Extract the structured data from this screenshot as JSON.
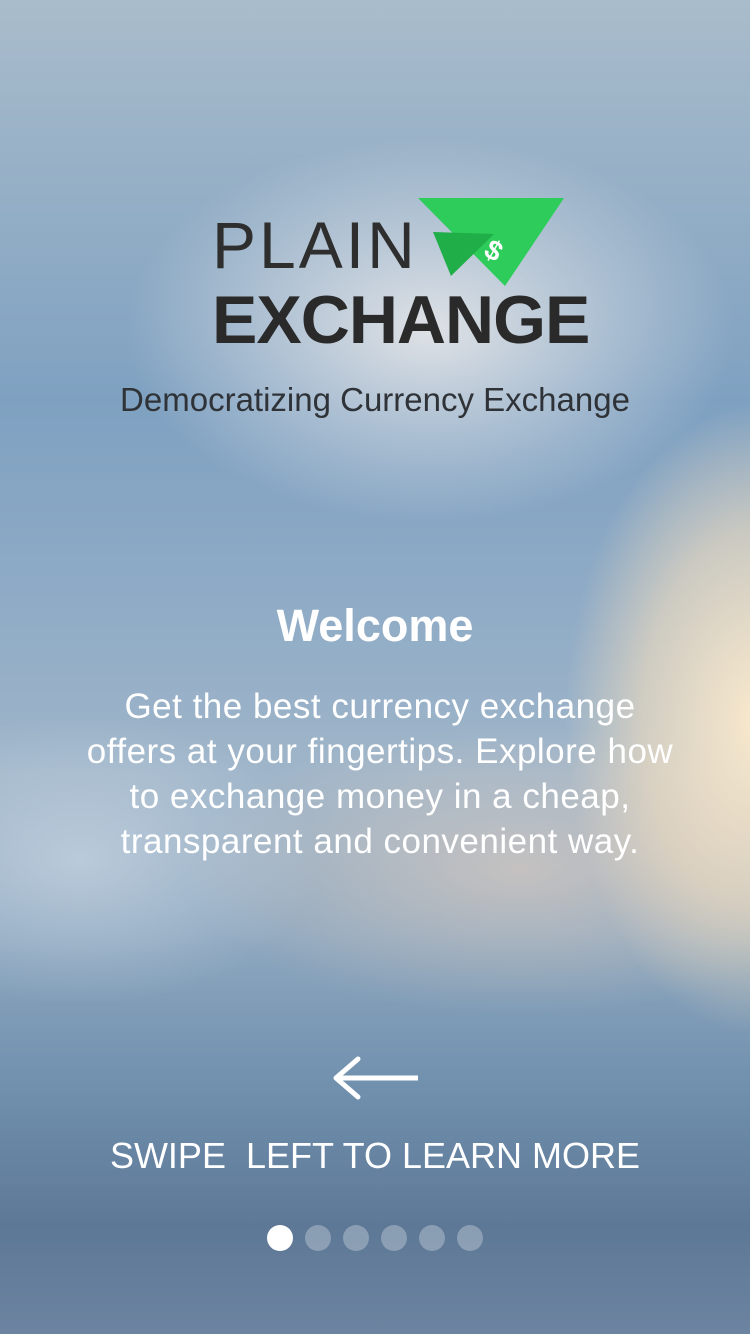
{
  "logo": {
    "line1": "PLAIN",
    "line2": "EXCHANGE",
    "icon": "paper-plane-dollar-icon",
    "icon_glyph": "$",
    "accent": "#2ecc5a"
  },
  "tagline": "Democratizing Currency Exchange",
  "welcome": {
    "title": "Welcome",
    "description": "Get the best currency exchange offers at your fingertips. Explore how to exchange money in a cheap, transparent and convenient way."
  },
  "swipe": {
    "icon": "arrow-left-icon",
    "label": "SWIPE  LEFT TO LEARN MORE"
  },
  "pager": {
    "total": 6,
    "active_index": 0
  },
  "colors": {
    "text_light": "#ffffff",
    "text_dark": "#2e2e2e",
    "dot_active": "#ffffff",
    "dot_inactive": "rgba(255,255,255,0.28)"
  }
}
